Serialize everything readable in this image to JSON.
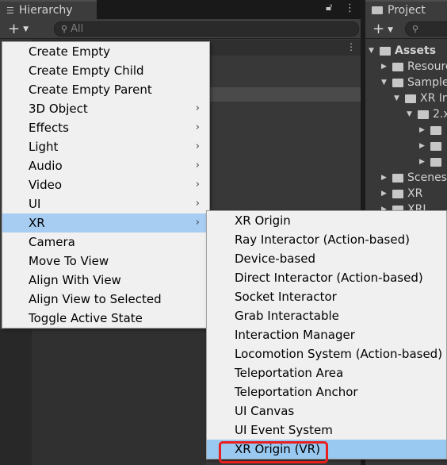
{
  "hierarchy": {
    "tab_icon": "list-icon",
    "title": "Hierarchy",
    "search_placeholder": "All"
  },
  "project": {
    "title": "Project",
    "tree": [
      {
        "label": "Assets",
        "indent": 0,
        "expanded": true
      },
      {
        "label": "Resources",
        "indent": 1,
        "expanded": false
      },
      {
        "label": "Samples",
        "indent": 1,
        "expanded": true
      },
      {
        "label": "XR Interaction Toolkit",
        "indent": 2,
        "expanded": true
      },
      {
        "label": "2.x",
        "indent": 3,
        "expanded": true
      },
      {
        "label": "",
        "indent": 4,
        "expanded": false
      },
      {
        "label": "",
        "indent": 4,
        "expanded": false
      },
      {
        "label": "",
        "indent": 4,
        "expanded": false
      },
      {
        "label": "Scenes",
        "indent": 1,
        "expanded": false
      },
      {
        "label": "XR",
        "indent": 1,
        "expanded": false
      },
      {
        "label": "XRI",
        "indent": 1,
        "expanded": false
      }
    ]
  },
  "context_menu": {
    "items": [
      {
        "label": "Create Empty",
        "submenu": false
      },
      {
        "label": "Create Empty Child",
        "submenu": false
      },
      {
        "label": "Create Empty Parent",
        "submenu": false
      },
      {
        "label": "3D Object",
        "submenu": true
      },
      {
        "label": "Effects",
        "submenu": true
      },
      {
        "label": "Light",
        "submenu": true
      },
      {
        "label": "Audio",
        "submenu": true
      },
      {
        "label": "Video",
        "submenu": true
      },
      {
        "label": "UI",
        "submenu": true
      },
      {
        "label": "XR",
        "submenu": true,
        "active": true
      },
      {
        "label": "Camera",
        "submenu": false
      },
      {
        "label": "Move To View",
        "submenu": false
      },
      {
        "label": "Align With View",
        "submenu": false
      },
      {
        "label": "Align View to Selected",
        "submenu": false
      },
      {
        "label": "Toggle Active State",
        "submenu": false
      }
    ]
  },
  "xr_submenu": {
    "items": [
      {
        "label": "XR Origin"
      },
      {
        "label": "Ray Interactor (Action-based)"
      },
      {
        "label": "Device-based"
      },
      {
        "label": "Direct Interactor (Action-based)"
      },
      {
        "label": "Socket Interactor"
      },
      {
        "label": "Grab Interactable"
      },
      {
        "label": "Interaction Manager"
      },
      {
        "label": "Locomotion System (Action-based)"
      },
      {
        "label": "Teleportation Area"
      },
      {
        "label": "Teleportation Anchor"
      },
      {
        "label": "UI Canvas"
      },
      {
        "label": "UI Event System"
      },
      {
        "label": "XR Origin (VR)",
        "highlighted": true
      }
    ]
  },
  "colors": {
    "menu_bg": "#f0f0f0",
    "menu_active": "#a7cdf2",
    "highlight_outline": "#e81f1f",
    "panel_bg": "#383838"
  }
}
